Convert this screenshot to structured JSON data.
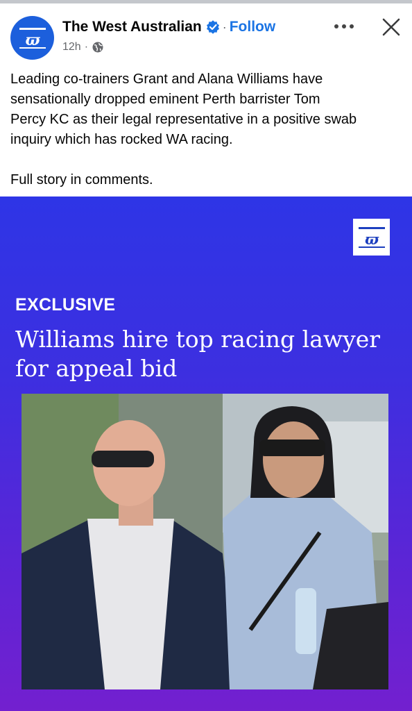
{
  "post": {
    "page_name": "The West Australian",
    "follow_label": "Follow",
    "separator": "·",
    "time": "12h",
    "caption_lines": [
      "Leading co-trainers Grant and Alana Williams have",
      "sensationally dropped eminent Perth barrister Tom",
      "Percy KC as their legal representative in a positive swab",
      "inquiry which has rocked WA racing."
    ],
    "caption_footer": "Full story in comments."
  },
  "card": {
    "kicker": "EXCLUSIVE",
    "headline_lines": [
      "Williams hire top racing lawyer",
      "for appeal bid"
    ]
  },
  "colors": {
    "brand_blue": "#1c5fdc",
    "follow_blue": "#1b74e4",
    "card_gradient_top": "#2e35e6",
    "card_gradient_bottom": "#7320cf"
  },
  "icons": {
    "avatar": "wa-logo-icon",
    "verified": "verified-badge-icon",
    "audience": "globe-icon",
    "more": "more-options-icon",
    "close": "close-icon"
  }
}
